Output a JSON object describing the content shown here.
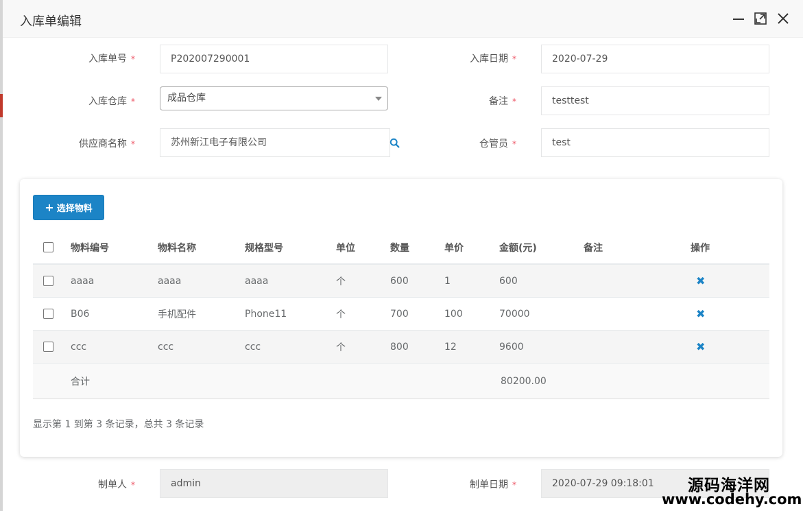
{
  "dialog": {
    "title": "入库单编辑",
    "minimize_icon": "minimize-icon",
    "maximize_icon": "maximize-icon",
    "close_icon": "close-icon"
  },
  "form": {
    "order_no_label": "入库单号",
    "order_no_value": "P202007290001",
    "date_label": "入库日期",
    "date_value": "2020-07-29",
    "warehouse_label": "入库仓库",
    "warehouse_value": "成品仓库",
    "remark_label": "备注",
    "remark_value": "testtest",
    "supplier_label": "供应商名称",
    "supplier_value": "苏州新江电子有限公司",
    "keeper_label": "仓管员",
    "keeper_value": "test",
    "creator_label": "制单人",
    "creator_value": "admin",
    "created_label": "制单日期",
    "created_value": "2020-07-29 09:18:01",
    "required_mark": "*"
  },
  "panel": {
    "select_button": "选择物料",
    "columns": [
      "物料编号",
      "物料名称",
      "规格型号",
      "单位",
      "数量",
      "单价",
      "金额(元)",
      "备注",
      "操作"
    ],
    "rows": [
      {
        "code": "aaaa",
        "name": "aaaa",
        "spec": "aaaa",
        "unit": "个",
        "qty": "600",
        "price": "1",
        "amount": "600",
        "remark": ""
      },
      {
        "code": "B06",
        "name": "手机配件",
        "spec": "Phone11",
        "unit": "个",
        "qty": "700",
        "price": "100",
        "amount": "70000",
        "remark": ""
      },
      {
        "code": "ccc",
        "name": "ccc",
        "spec": "ccc",
        "unit": "个",
        "qty": "800",
        "price": "12",
        "amount": "9600",
        "remark": ""
      }
    ],
    "total_label": "合计",
    "total_amount": "80200.00",
    "pagination": "显示第 1 到第 3 条记录，总共 3 条记录"
  },
  "watermark": {
    "line1": "源码海洋网",
    "line2": "www.codehy.com"
  },
  "colors": {
    "primary": "#1c84c6",
    "required": "#ed5565"
  }
}
